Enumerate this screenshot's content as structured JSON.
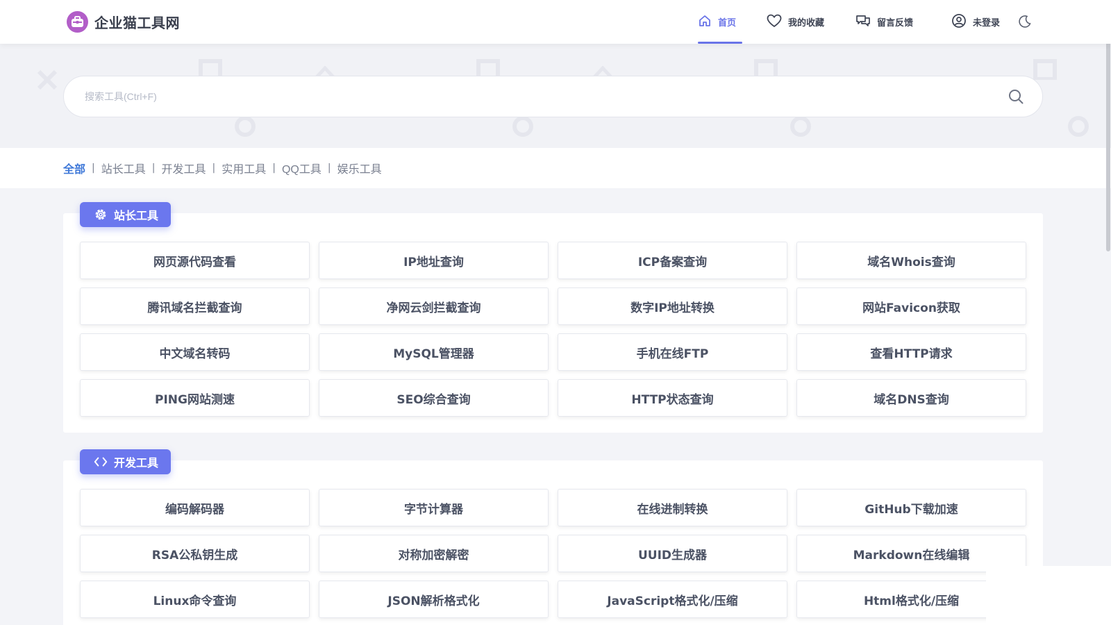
{
  "brand": {
    "title": "企业猫工具网",
    "logo_icon": "toolbox-icon",
    "logo_color": "#b25ec8"
  },
  "nav": {
    "items": [
      {
        "label": "首页",
        "icon": "home-icon",
        "active": true
      },
      {
        "label": "我的收藏",
        "icon": "heart-icon",
        "active": false
      },
      {
        "label": "留言反馈",
        "icon": "chat-icon",
        "active": false
      },
      {
        "label": "未登录",
        "icon": "user-icon",
        "active": false
      }
    ],
    "theme_toggle_icon": "moon-icon",
    "accent": "#6a74e8"
  },
  "search": {
    "placeholder": "搜索工具(Ctrl+F)",
    "value": "",
    "icon": "search-icon"
  },
  "filters": {
    "items": [
      "全部",
      "站长工具",
      "开发工具",
      "实用工具",
      "QQ工具",
      "娱乐工具"
    ],
    "active": "全部",
    "separator": "|"
  },
  "sections": [
    {
      "title": "站长工具",
      "icon": "gear-icon",
      "tools": [
        "网页源代码查看",
        "IP地址查询",
        "ICP备案查询",
        "域名Whois查询",
        "腾讯域名拦截查询",
        "净网云剑拦截查询",
        "数字IP地址转换",
        "网站Favicon获取",
        "中文域名转码",
        "MySQL管理器",
        "手机在线FTP",
        "查看HTTP请求",
        "PING网站测速",
        "SEO综合查询",
        "HTTP状态查询",
        "域名DNS查询"
      ]
    },
    {
      "title": "开发工具",
      "icon": "code-icon",
      "tools": [
        "编码解码器",
        "字节计算器",
        "在线进制转换",
        "GitHub下载加速",
        "RSA公私钥生成",
        "对称加密解密",
        "UUID生成器",
        "Markdown在线编辑",
        "Linux命令查询",
        "JSON解析格式化",
        "JavaScript格式化/压缩",
        "Html格式化/压缩"
      ]
    }
  ],
  "colors": {
    "badge": "#6b77ee",
    "filter_active": "#3f78d8",
    "page_bg": "#f3f4f8"
  }
}
